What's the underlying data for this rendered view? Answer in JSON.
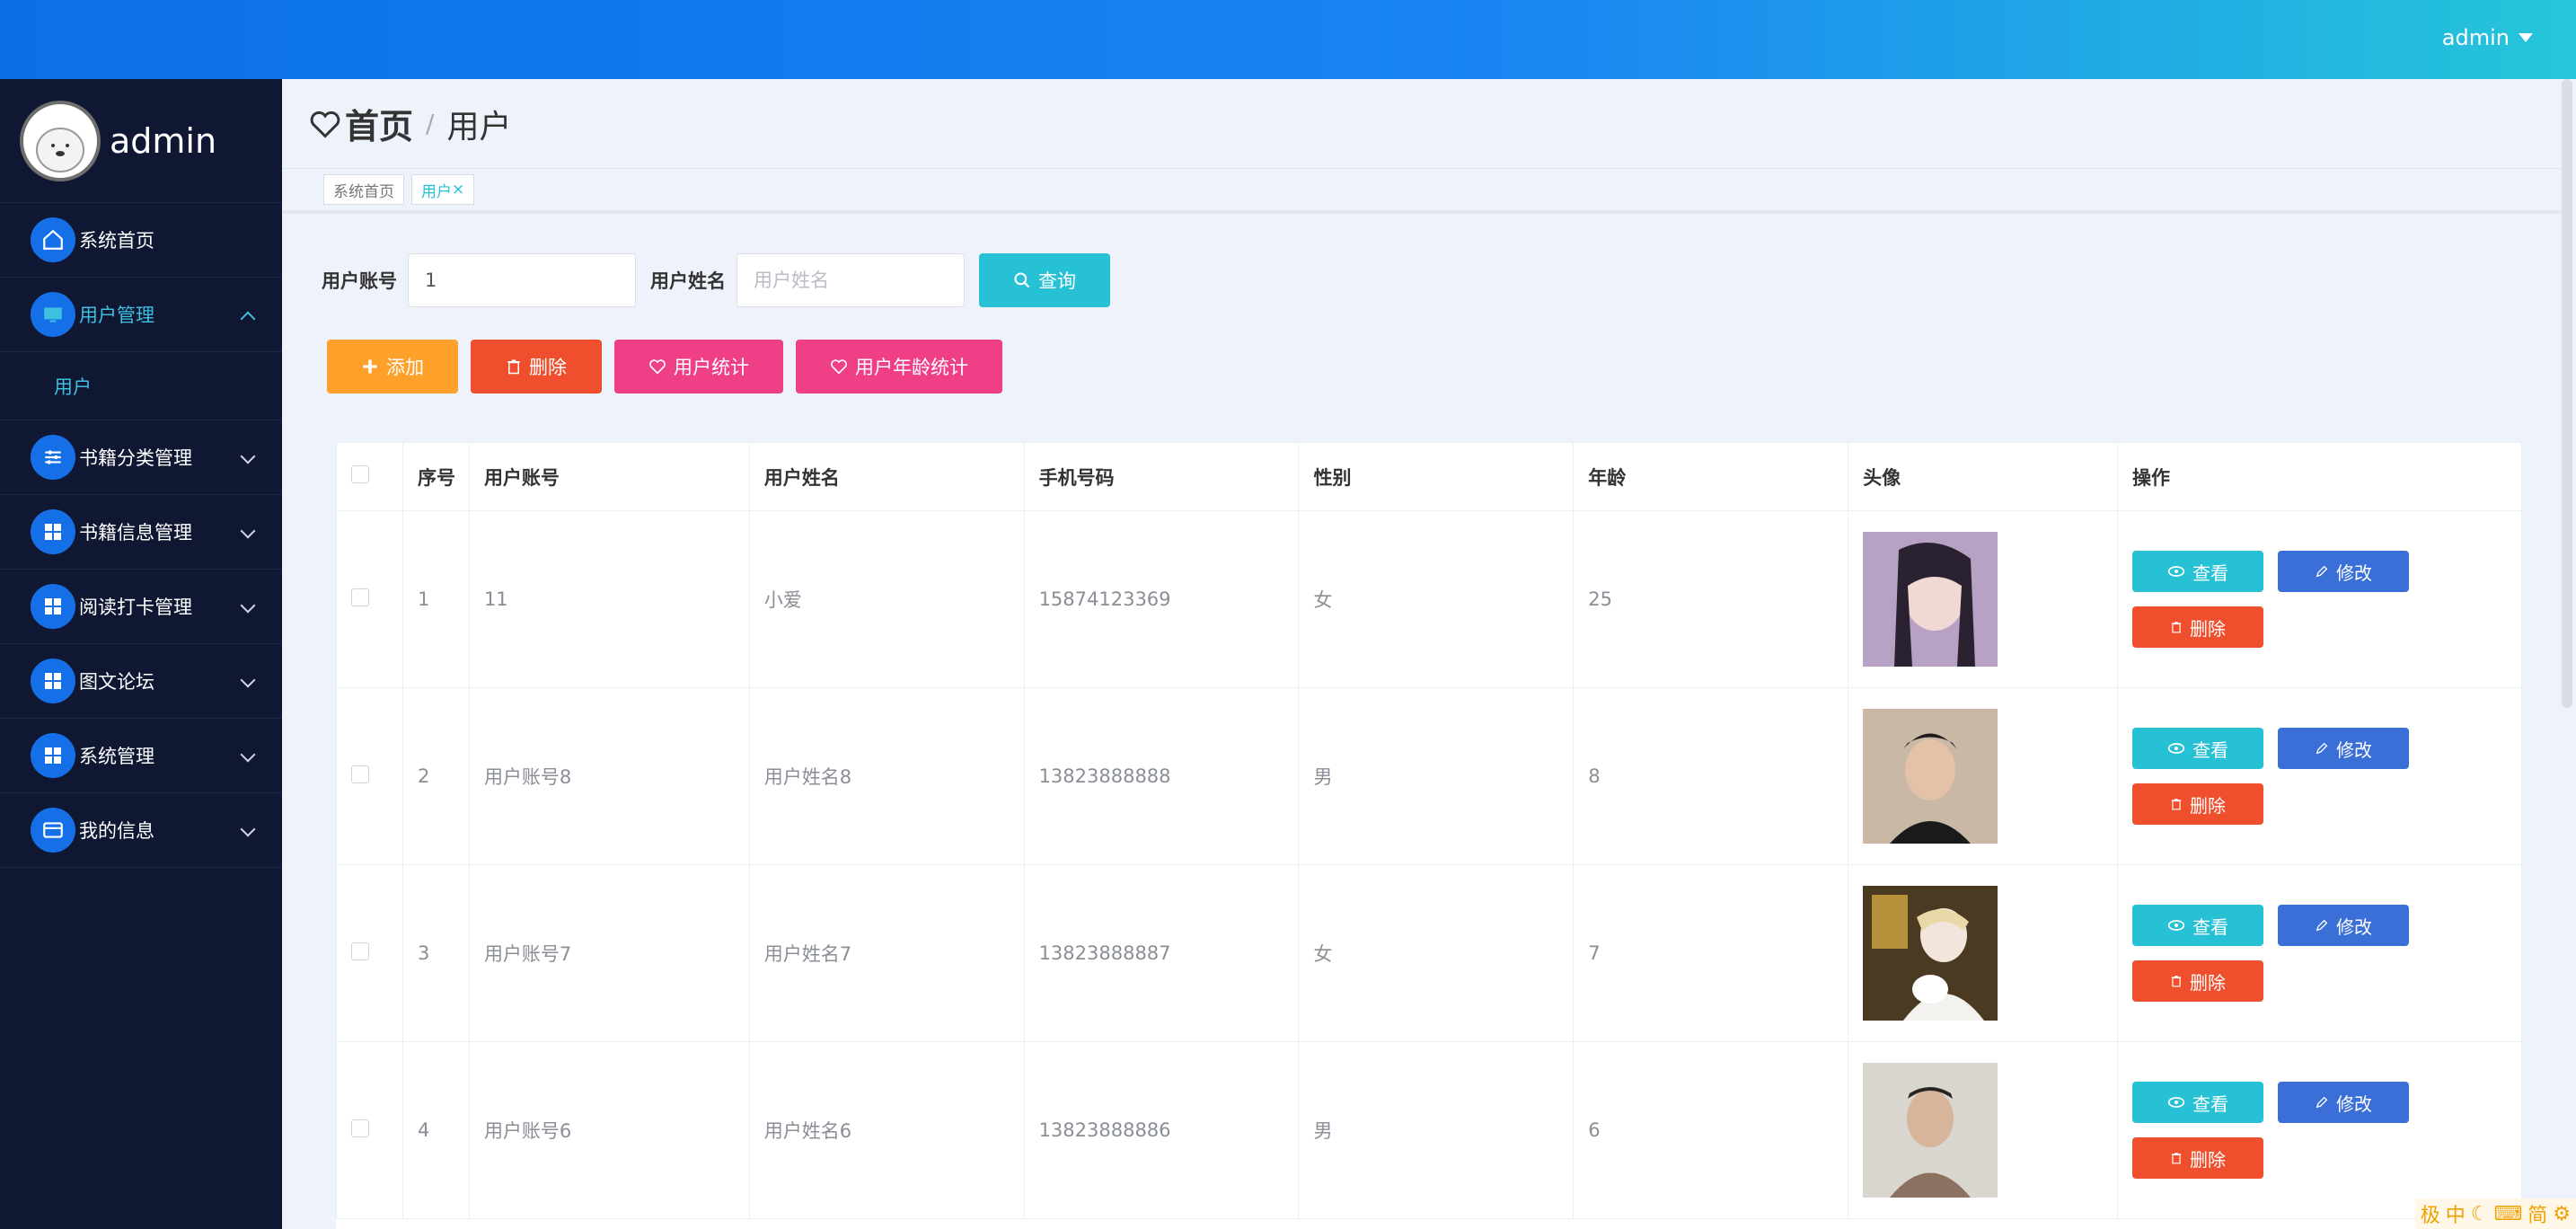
{
  "topbar": {
    "user": "admin"
  },
  "sidebar": {
    "brand": "admin",
    "items": [
      {
        "label": "系统首页",
        "icon": "home-icon"
      },
      {
        "label": "用户管理",
        "icon": "monitor-icon",
        "expanded": true
      },
      {
        "label": "书籍分类管理",
        "icon": "sliders-icon"
      },
      {
        "label": "书籍信息管理",
        "icon": "grid-icon"
      },
      {
        "label": "阅读打卡管理",
        "icon": "grid-icon"
      },
      {
        "label": "图文论坛",
        "icon": "grid-icon"
      },
      {
        "label": "系统管理",
        "icon": "grid-icon"
      },
      {
        "label": "我的信息",
        "icon": "wallet-icon"
      }
    ],
    "subitem": "用户"
  },
  "breadcrumb": {
    "home": "首页",
    "sep": "/",
    "current": "用户"
  },
  "tags": [
    {
      "label": "系统首页"
    },
    {
      "label": "用户",
      "close": "×"
    }
  ],
  "search": {
    "account_label": "用户账号",
    "account_value": "1",
    "name_label": "用户姓名",
    "name_placeholder": "用户姓名",
    "query_button": "查询"
  },
  "actions": {
    "add": "添加",
    "delete": "删除",
    "stats": "用户统计",
    "age_stats": "用户年龄统计"
  },
  "table": {
    "headers": [
      "序号",
      "用户账号",
      "用户姓名",
      "手机号码",
      "性别",
      "年龄",
      "头像",
      "操作"
    ],
    "rows": [
      {
        "no": "1",
        "account": "11",
        "name": "小爱",
        "phone": "15874123369",
        "gender": "女",
        "age": "25"
      },
      {
        "no": "2",
        "account": "用户账号8",
        "name": "用户姓名8",
        "phone": "13823888888",
        "gender": "男",
        "age": "8"
      },
      {
        "no": "3",
        "account": "用户账号7",
        "name": "用户姓名7",
        "phone": "13823888887",
        "gender": "女",
        "age": "7"
      },
      {
        "no": "4",
        "account": "用户账号6",
        "name": "用户姓名6",
        "phone": "13823888886",
        "gender": "男",
        "age": "6"
      }
    ],
    "row_buttons": {
      "view": "查看",
      "edit": "修改",
      "delete": "删除"
    }
  },
  "ime": {
    "items": [
      "极",
      "中",
      "简"
    ]
  },
  "colors": {
    "primary": "#27c1d6",
    "sidebar": "#0f1733",
    "add": "#fea12a",
    "danger": "#ef4f2c",
    "pink": "#ee3f87",
    "edit": "#3b6fd8"
  }
}
